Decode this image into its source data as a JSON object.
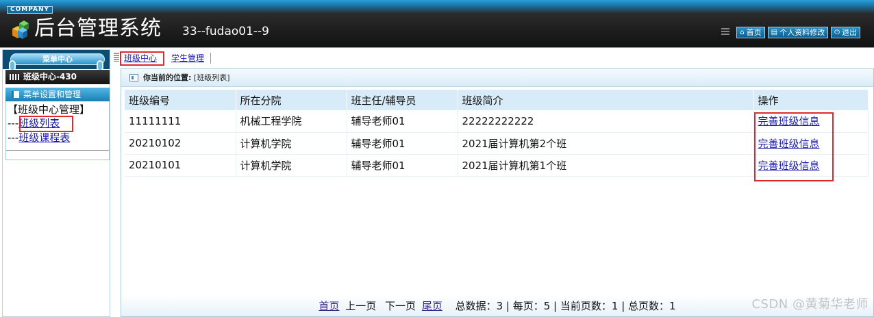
{
  "header": {
    "company": "COMPANY",
    "title": "后台管理系统",
    "user_info": "33--fudao01--9",
    "links": [
      {
        "icon": "home-icon",
        "label": "首页"
      },
      {
        "icon": "profile-icon",
        "label": "个人资料修改"
      },
      {
        "icon": "power-icon",
        "label": "退出"
      }
    ]
  },
  "sidebar": {
    "menu_center": "菜单中心",
    "class_center": "班级中心-430",
    "menu_settings": "菜单设置和管理",
    "tree_head": "【班级中心管理】",
    "items": [
      {
        "prefix": "---",
        "label": "班级列表"
      },
      {
        "prefix": "---",
        "label": "班级课程表"
      }
    ]
  },
  "tabs": [
    {
      "label": "班级中心"
    },
    {
      "label": "学生管理"
    }
  ],
  "location": {
    "prefix": "你当前的位置:",
    "path": "[班级列表]"
  },
  "table": {
    "headers": [
      "班级编号",
      "所在分院",
      "班主任/辅导员",
      "班级简介",
      "操作"
    ],
    "rows": [
      [
        "11111111",
        "机械工程学院",
        "辅导老师01",
        "22222222222",
        "完善班级信息"
      ],
      [
        "20210102",
        "计算机学院",
        "辅导老师01",
        "2021届计算机第2个班",
        "完善班级信息"
      ],
      [
        "20210101",
        "计算机学院",
        "辅导老师01",
        "2021届计算机第1个班",
        "完善班级信息"
      ]
    ]
  },
  "pager": {
    "first": "首页",
    "prev": "上一页",
    "next": "下一页",
    "last": "尾页",
    "summary": "总数据：3 | 每页：5 | 当前页数：1 | 总页数：1"
  },
  "watermark": "CSDN @黄菊华老师",
  "colors": {
    "accent": "#1a80b8",
    "header_dark": "#111111",
    "highlight": "#e0282e",
    "link": "#1a1ab0"
  }
}
